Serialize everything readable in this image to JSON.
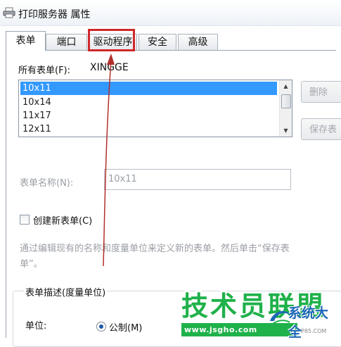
{
  "window": {
    "title": "打印服务器 属性"
  },
  "tabs": [
    {
      "label": "表单",
      "active": true
    },
    {
      "label": "端口",
      "active": false
    },
    {
      "label": "驱动程序",
      "active": false,
      "highlighted": true
    },
    {
      "label": "安全",
      "active": false
    },
    {
      "label": "高级",
      "active": false
    }
  ],
  "forms_section": {
    "label": "所有表单(F):",
    "server_name": "XINGGE"
  },
  "forms_list": {
    "items": [
      "10x11",
      "10x14",
      "11x17",
      "12x11"
    ],
    "selected": "10x11"
  },
  "side_buttons": {
    "delete": "删除",
    "save_form": "保存表"
  },
  "form_name": {
    "label": "表单名称(N):",
    "value": "10x11"
  },
  "create_new": {
    "label": "创建新表单(C)",
    "checked": false
  },
  "description": "通过编辑现有的名称和度量单位来定义新的表单。然后单击“保存表单”。",
  "form_description": {
    "legend": "表单描述(度量单位)",
    "unit_label": "单位:",
    "metric_option": "公制(M)"
  },
  "watermark": {
    "main": "技术员联盟",
    "url": "www.jsgho.com",
    "side": "系统大全",
    "small": "P85.COM"
  },
  "colors": {
    "highlight": "#d0282a",
    "selection": "#3399ff",
    "annotation_arrow": "#b2302b",
    "watermark_green": "#1fb14a",
    "watermark_blue": "#1c67b7"
  }
}
